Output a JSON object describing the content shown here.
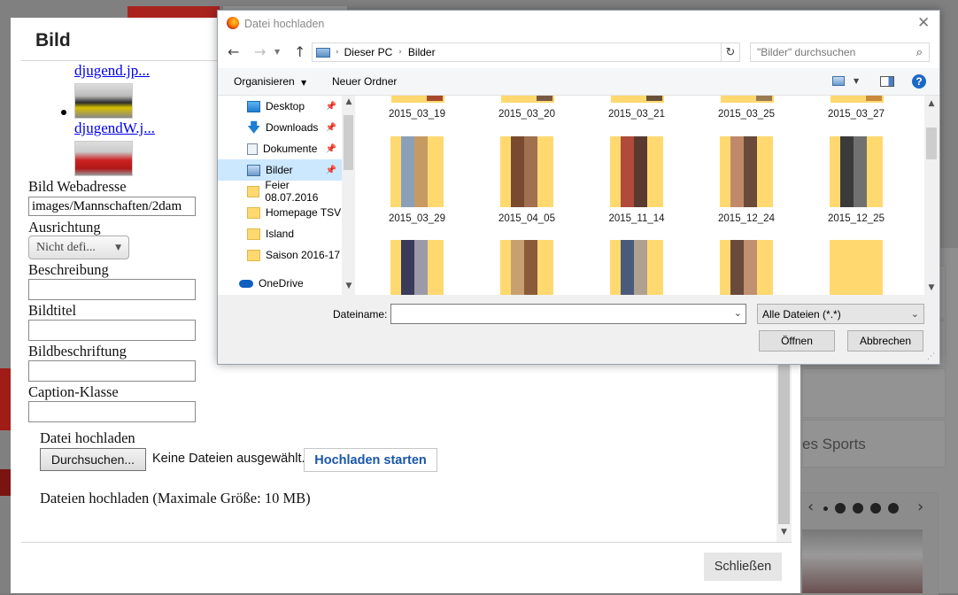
{
  "background": {
    "red_button_text": "",
    "right_menu_text": "es Sports",
    "slider_prev": "‹",
    "slider_next": "›"
  },
  "modal": {
    "title": "Bild",
    "images": [
      {
        "link": "djugend.jp..."
      },
      {
        "link": "djugendW.j..."
      }
    ],
    "fields": {
      "webadresse_label": "Bild Webadresse",
      "webadresse_value": "images/Mannschaften/2dam",
      "ausrichtung_label": "Ausrichtung",
      "ausrichtung_value": "Nicht defi...",
      "beschreibung_label": "Beschreibung",
      "bildtitel_label": "Bildtitel",
      "bildbeschriftung_label": "Bildbeschriftung",
      "caption_label": "Caption-Klasse"
    },
    "upload": {
      "label": "Datei hochladen",
      "browse_button": "Durchsuchen...",
      "no_file": "Keine Dateien ausgewählt.",
      "start_button": "Hochladen starten",
      "info": "Dateien hochladen (Maximale Größe: 10 MB)"
    },
    "close_button": "Schließen"
  },
  "dialog": {
    "title": "Datei hochladen",
    "breadcrumb": [
      "Dieser PC",
      "Bilder"
    ],
    "search_placeholder": "\"Bilder\" durchsuchen",
    "organize": "Organisieren",
    "new_folder": "Neuer Ordner",
    "nav": [
      {
        "label": "Desktop",
        "icon": "desktop-icon",
        "pinned": true
      },
      {
        "label": "Downloads",
        "icon": "download-icon",
        "pinned": true
      },
      {
        "label": "Dokumente",
        "icon": "document-icon",
        "pinned": true
      },
      {
        "label": "Bilder",
        "icon": "pictures-icon",
        "pinned": true,
        "selected": true
      },
      {
        "label": "Feier 08.07.2016",
        "icon": "folder-icon",
        "pinned": false
      },
      {
        "label": "Homepage TSV",
        "icon": "folder-icon",
        "pinned": false
      },
      {
        "label": "Island",
        "icon": "folder-icon",
        "pinned": false
      },
      {
        "label": "Saison 2016-17",
        "icon": "folder-icon",
        "pinned": false
      },
      {
        "label": "OneDrive",
        "icon": "cloud-icon",
        "pinned": false
      }
    ],
    "folders_row1": [
      "2015_03_19",
      "2015_03_20",
      "2015_03_21",
      "2015_03_25",
      "2015_03_27"
    ],
    "folders_row2": [
      "2015_03_29",
      "2015_04_05",
      "2015_11_14",
      "2015_12_24",
      "2015_12_25"
    ],
    "folders_row3": [
      "",
      "",
      "",
      "",
      ""
    ],
    "filename_label": "Dateiname:",
    "filter_value": "Alle Dateien (*.*)",
    "open_button": "Öffnen",
    "cancel_button": "Abbrechen"
  }
}
